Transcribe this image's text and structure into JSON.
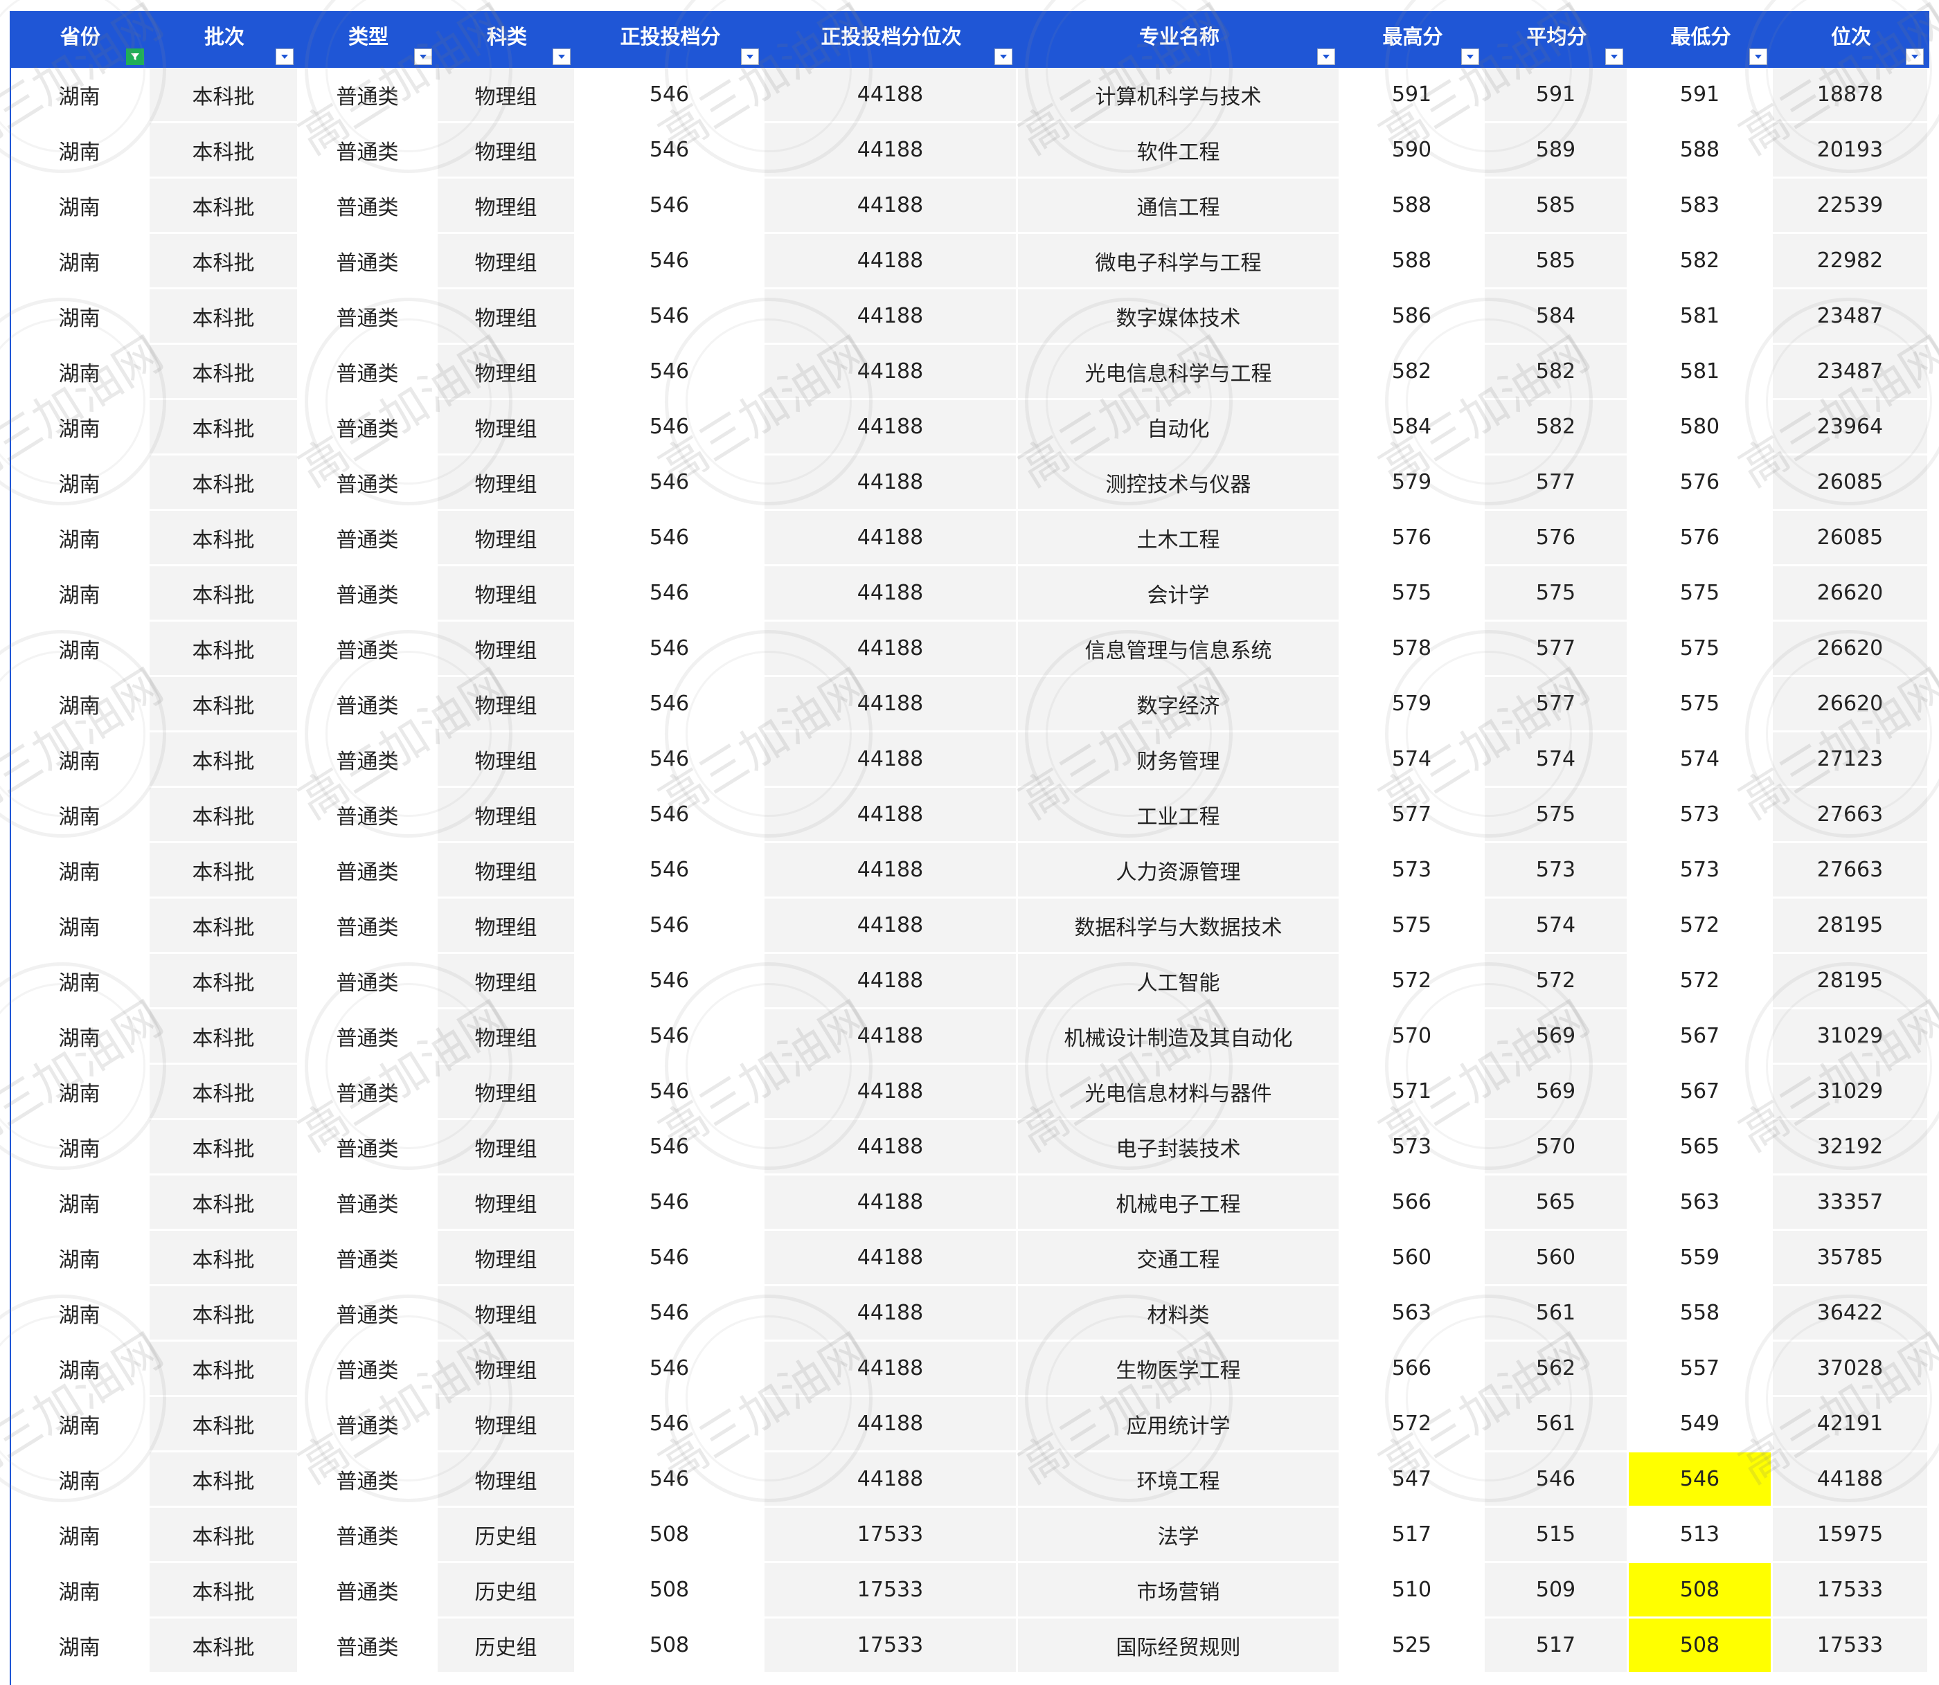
{
  "header": {
    "columns": [
      "省份",
      "批次",
      "类型",
      "科类",
      "正投投档分",
      "正投投档分位次",
      "专业名称",
      "最高分",
      "平均分",
      "最低分",
      "位次"
    ]
  },
  "watermark": "高三加油网",
  "rows": [
    [
      "湖南",
      "本科批",
      "普通类",
      "物理组",
      "546",
      "44188",
      "计算机科学与技术",
      "591",
      "591",
      "591",
      "18878"
    ],
    [
      "湖南",
      "本科批",
      "普通类",
      "物理组",
      "546",
      "44188",
      "软件工程",
      "590",
      "589",
      "588",
      "20193"
    ],
    [
      "湖南",
      "本科批",
      "普通类",
      "物理组",
      "546",
      "44188",
      "通信工程",
      "588",
      "585",
      "583",
      "22539"
    ],
    [
      "湖南",
      "本科批",
      "普通类",
      "物理组",
      "546",
      "44188",
      "微电子科学与工程",
      "588",
      "585",
      "582",
      "22982"
    ],
    [
      "湖南",
      "本科批",
      "普通类",
      "物理组",
      "546",
      "44188",
      "数字媒体技术",
      "586",
      "584",
      "581",
      "23487"
    ],
    [
      "湖南",
      "本科批",
      "普通类",
      "物理组",
      "546",
      "44188",
      "光电信息科学与工程",
      "582",
      "582",
      "581",
      "23487"
    ],
    [
      "湖南",
      "本科批",
      "普通类",
      "物理组",
      "546",
      "44188",
      "自动化",
      "584",
      "582",
      "580",
      "23964"
    ],
    [
      "湖南",
      "本科批",
      "普通类",
      "物理组",
      "546",
      "44188",
      "测控技术与仪器",
      "579",
      "577",
      "576",
      "26085"
    ],
    [
      "湖南",
      "本科批",
      "普通类",
      "物理组",
      "546",
      "44188",
      "土木工程",
      "576",
      "576",
      "576",
      "26085"
    ],
    [
      "湖南",
      "本科批",
      "普通类",
      "物理组",
      "546",
      "44188",
      "会计学",
      "575",
      "575",
      "575",
      "26620"
    ],
    [
      "湖南",
      "本科批",
      "普通类",
      "物理组",
      "546",
      "44188",
      "信息管理与信息系统",
      "578",
      "577",
      "575",
      "26620"
    ],
    [
      "湖南",
      "本科批",
      "普通类",
      "物理组",
      "546",
      "44188",
      "数字经济",
      "579",
      "577",
      "575",
      "26620"
    ],
    [
      "湖南",
      "本科批",
      "普通类",
      "物理组",
      "546",
      "44188",
      "财务管理",
      "574",
      "574",
      "574",
      "27123"
    ],
    [
      "湖南",
      "本科批",
      "普通类",
      "物理组",
      "546",
      "44188",
      "工业工程",
      "577",
      "575",
      "573",
      "27663"
    ],
    [
      "湖南",
      "本科批",
      "普通类",
      "物理组",
      "546",
      "44188",
      "人力资源管理",
      "573",
      "573",
      "573",
      "27663"
    ],
    [
      "湖南",
      "本科批",
      "普通类",
      "物理组",
      "546",
      "44188",
      "数据科学与大数据技术",
      "575",
      "574",
      "572",
      "28195"
    ],
    [
      "湖南",
      "本科批",
      "普通类",
      "物理组",
      "546",
      "44188",
      "人工智能",
      "572",
      "572",
      "572",
      "28195"
    ],
    [
      "湖南",
      "本科批",
      "普通类",
      "物理组",
      "546",
      "44188",
      "机械设计制造及其自动化",
      "570",
      "569",
      "567",
      "31029"
    ],
    [
      "湖南",
      "本科批",
      "普通类",
      "物理组",
      "546",
      "44188",
      "光电信息材料与器件",
      "571",
      "569",
      "567",
      "31029"
    ],
    [
      "湖南",
      "本科批",
      "普通类",
      "物理组",
      "546",
      "44188",
      "电子封装技术",
      "573",
      "570",
      "565",
      "32192"
    ],
    [
      "湖南",
      "本科批",
      "普通类",
      "物理组",
      "546",
      "44188",
      "机械电子工程",
      "566",
      "565",
      "563",
      "33357"
    ],
    [
      "湖南",
      "本科批",
      "普通类",
      "物理组",
      "546",
      "44188",
      "交通工程",
      "560",
      "560",
      "559",
      "35785"
    ],
    [
      "湖南",
      "本科批",
      "普通类",
      "物理组",
      "546",
      "44188",
      "材料类",
      "563",
      "561",
      "558",
      "36422"
    ],
    [
      "湖南",
      "本科批",
      "普通类",
      "物理组",
      "546",
      "44188",
      "生物医学工程",
      "566",
      "562",
      "557",
      "37028"
    ],
    [
      "湖南",
      "本科批",
      "普通类",
      "物理组",
      "546",
      "44188",
      "应用统计学",
      "572",
      "561",
      "549",
      "42191"
    ],
    [
      "湖南",
      "本科批",
      "普通类",
      "物理组",
      "546",
      "44188",
      "环境工程",
      "547",
      "546",
      "546",
      "44188"
    ],
    [
      "湖南",
      "本科批",
      "普通类",
      "历史组",
      "508",
      "17533",
      "法学",
      "517",
      "515",
      "513",
      "15975"
    ],
    [
      "湖南",
      "本科批",
      "普通类",
      "历史组",
      "508",
      "17533",
      "市场营销",
      "510",
      "509",
      "508",
      "17533"
    ],
    [
      "湖南",
      "本科批",
      "普通类",
      "历史组",
      "508",
      "17533",
      "国际经贸规则",
      "525",
      "517",
      "508",
      "17533"
    ]
  ],
  "highlighted_rows": [
    25,
    27,
    28
  ],
  "colors": {
    "header": "#1f56d6",
    "highlight": "#ffff00",
    "filter_active": "#1fae58"
  }
}
